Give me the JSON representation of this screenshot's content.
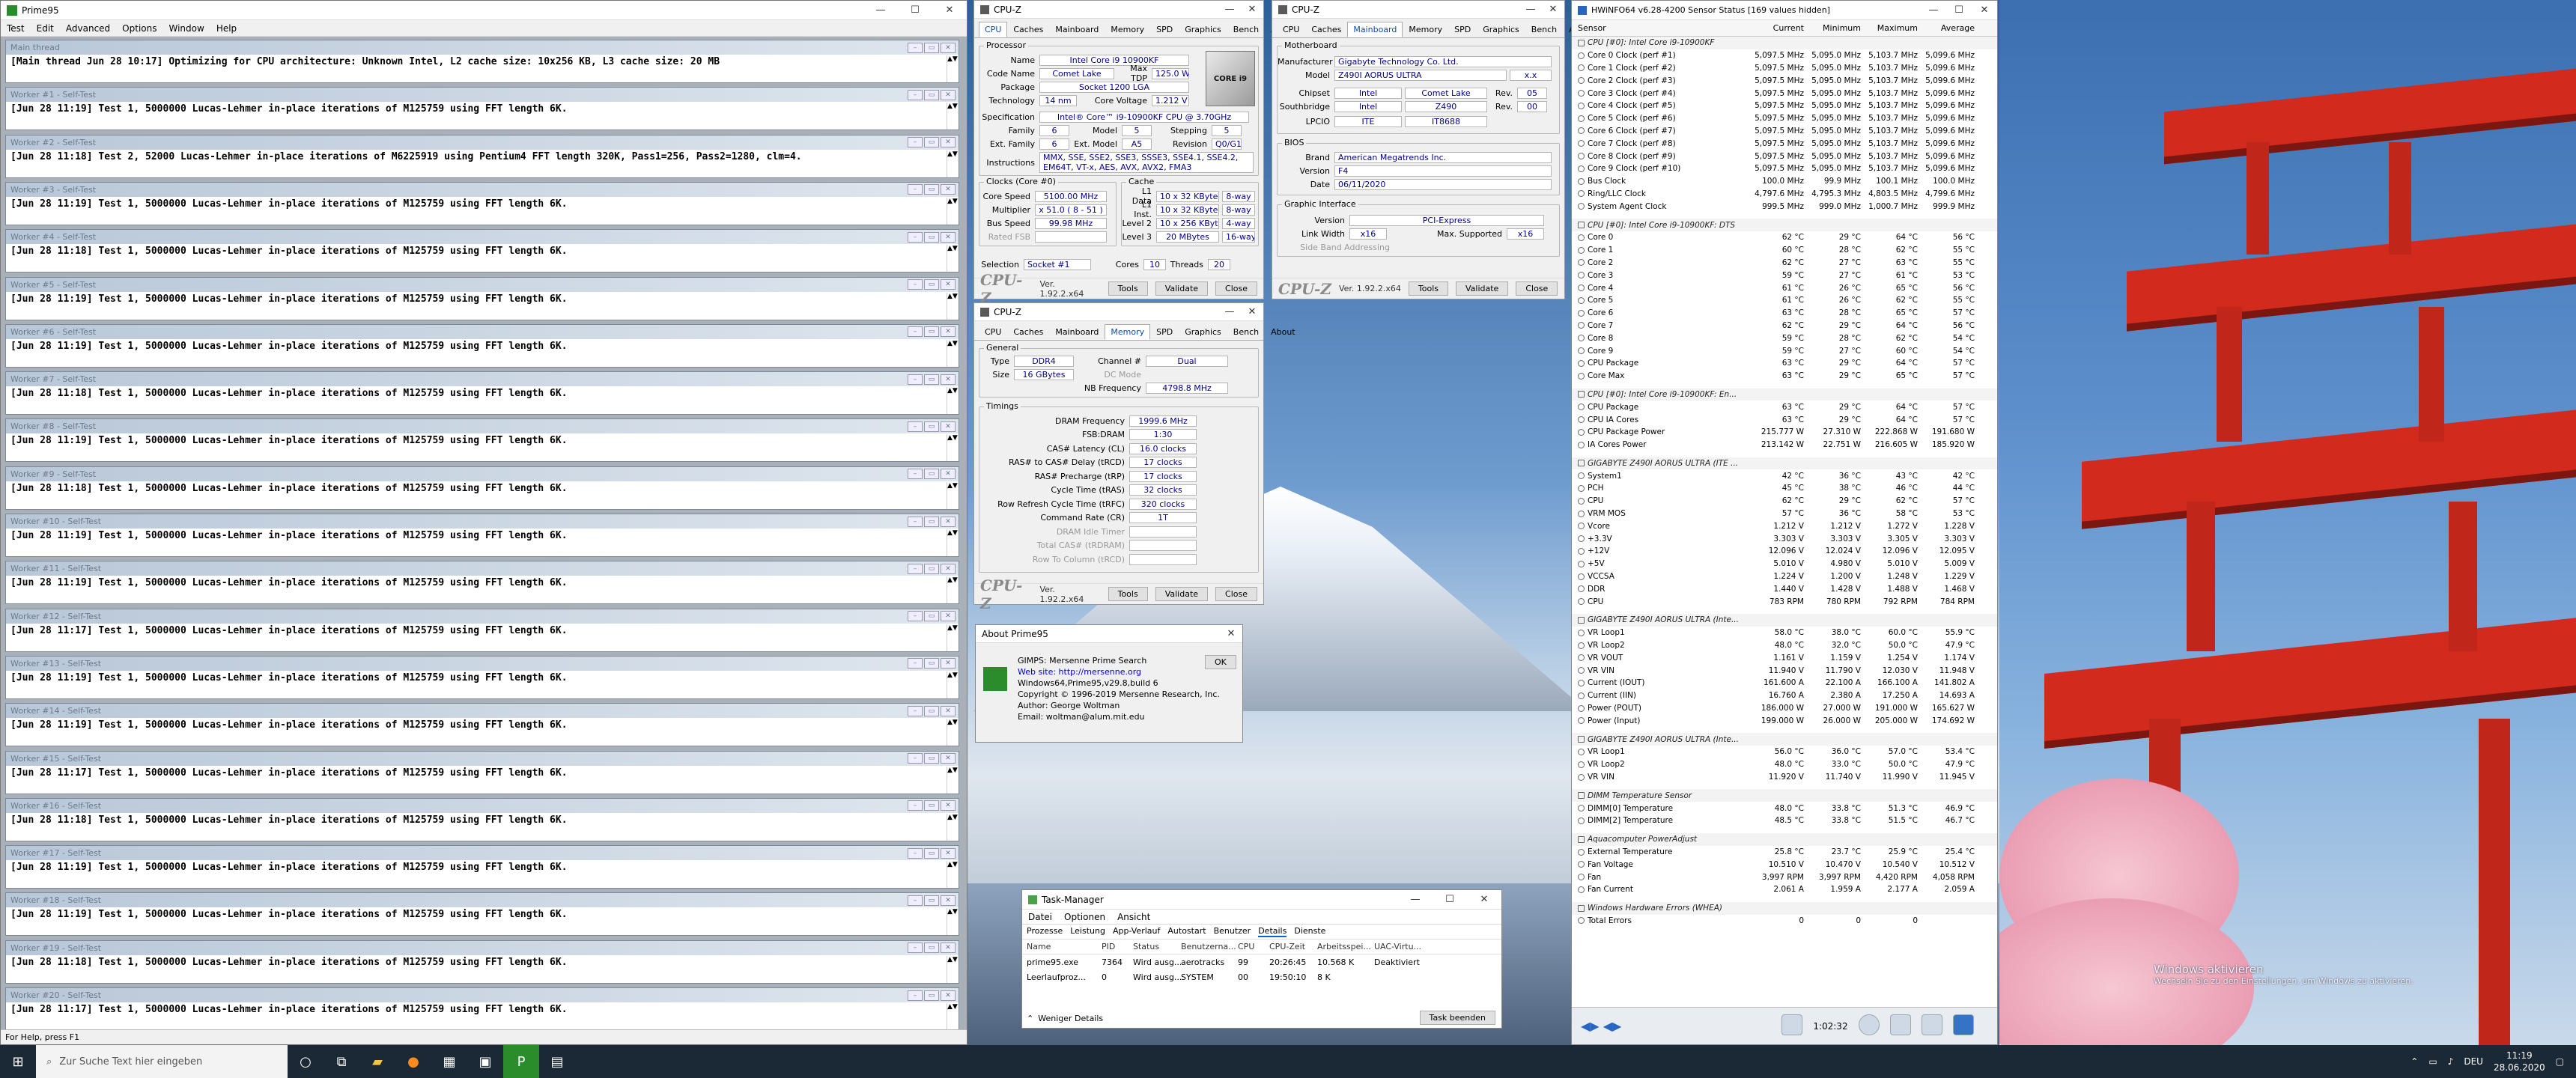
{
  "prime": {
    "title": "Prime95",
    "menu": [
      "Test",
      "Edit",
      "Advanced",
      "Options",
      "Window",
      "Help"
    ],
    "status": "For Help, press F1",
    "workers": [
      {
        "title": "Main thread",
        "line": "[Main thread Jun 28 10:17] Optimizing for CPU architecture: Unknown Intel, L2 cache size: 10x256 KB, L3 cache size: 20 MB"
      },
      {
        "title": "Worker #1 - Self-Test",
        "line": "[Jun 28 11:19] Test 1, 5000000 Lucas-Lehmer in-place iterations of M125759 using FFT length 6K."
      },
      {
        "title": "Worker #2 - Self-Test",
        "line": "[Jun 28 11:18] Test 2, 52000 Lucas-Lehmer in-place iterations of M6225919 using Pentium4 FFT length 320K, Pass1=256, Pass2=1280, clm=4."
      },
      {
        "title": "Worker #3 - Self-Test",
        "line": "[Jun 28 11:19] Test 1, 5000000 Lucas-Lehmer in-place iterations of M125759 using FFT length 6K."
      },
      {
        "title": "Worker #4 - Self-Test",
        "line": "[Jun 28 11:18] Test 1, 5000000 Lucas-Lehmer in-place iterations of M125759 using FFT length 6K."
      },
      {
        "title": "Worker #5 - Self-Test",
        "line": "[Jun 28 11:19] Test 1, 5000000 Lucas-Lehmer in-place iterations of M125759 using FFT length 6K."
      },
      {
        "title": "Worker #6 - Self-Test",
        "line": "[Jun 28 11:19] Test 1, 5000000 Lucas-Lehmer in-place iterations of M125759 using FFT length 6K."
      },
      {
        "title": "Worker #7 - Self-Test",
        "line": "[Jun 28 11:18] Test 1, 5000000 Lucas-Lehmer in-place iterations of M125759 using FFT length 6K."
      },
      {
        "title": "Worker #8 - Self-Test",
        "line": "[Jun 28 11:19] Test 1, 5000000 Lucas-Lehmer in-place iterations of M125759 using FFT length 6K."
      },
      {
        "title": "Worker #9 - Self-Test",
        "line": "[Jun 28 11:18] Test 1, 5000000 Lucas-Lehmer in-place iterations of M125759 using FFT length 6K."
      },
      {
        "title": "Worker #10 - Self-Test",
        "line": "[Jun 28 11:19] Test 1, 5000000 Lucas-Lehmer in-place iterations of M125759 using FFT length 6K."
      },
      {
        "title": "Worker #11 - Self-Test",
        "line": "[Jun 28 11:19] Test 1, 5000000 Lucas-Lehmer in-place iterations of M125759 using FFT length 6K."
      },
      {
        "title": "Worker #12 - Self-Test",
        "line": "[Jun 28 11:17] Test 1, 5000000 Lucas-Lehmer in-place iterations of M125759 using FFT length 6K."
      },
      {
        "title": "Worker #13 - Self-Test",
        "line": "[Jun 28 11:19] Test 1, 5000000 Lucas-Lehmer in-place iterations of M125759 using FFT length 6K."
      },
      {
        "title": "Worker #14 - Self-Test",
        "line": "[Jun 28 11:19] Test 1, 5000000 Lucas-Lehmer in-place iterations of M125759 using FFT length 6K."
      },
      {
        "title": "Worker #15 - Self-Test",
        "line": "[Jun 28 11:17] Test 1, 5000000 Lucas-Lehmer in-place iterations of M125759 using FFT length 6K."
      },
      {
        "title": "Worker #16 - Self-Test",
        "line": "[Jun 28 11:18] Test 1, 5000000 Lucas-Lehmer in-place iterations of M125759 using FFT length 6K."
      },
      {
        "title": "Worker #17 - Self-Test",
        "line": "[Jun 28 11:19] Test 1, 5000000 Lucas-Lehmer in-place iterations of M125759 using FFT length 6K."
      },
      {
        "title": "Worker #18 - Self-Test",
        "line": "[Jun 28 11:19] Test 1, 5000000 Lucas-Lehmer in-place iterations of M125759 using FFT length 6K."
      },
      {
        "title": "Worker #19 - Self-Test",
        "line": "[Jun 28 11:18] Test 1, 5000000 Lucas-Lehmer in-place iterations of M125759 using FFT length 6K."
      },
      {
        "title": "Worker #20 - Self-Test",
        "line": "[Jun 28 11:17] Test 1, 5000000 Lucas-Lehmer in-place iterations of M125759 using FFT length 6K."
      }
    ]
  },
  "cpuz1": {
    "title": "CPU-Z",
    "tabs": [
      "CPU",
      "Caches",
      "Mainboard",
      "Memory",
      "SPD",
      "Graphics",
      "Bench",
      "About"
    ],
    "processor": "Processor",
    "name_k": "Name",
    "name": "Intel Core i9 10900KF",
    "code_k": "Code Name",
    "code": "Comet Lake",
    "tdp_k": "Max TDP",
    "tdp": "125.0 W",
    "pkg_k": "Package",
    "pkg": "Socket 1200 LGA",
    "tech_k": "Technology",
    "tech": "14 nm",
    "volt_k": "Core Voltage",
    "volt": "1.212 V",
    "spec_k": "Specification",
    "spec": "Intel® Core™ i9-10900KF CPU @ 3.70GHz",
    "fam_k": "Family",
    "fam": "6",
    "model_k": "Model",
    "model": "5",
    "step_k": "Stepping",
    "step": "5",
    "efam_k": "Ext. Family",
    "efam": "6",
    "emod_k": "Ext. Model",
    "emod": "A5",
    "rev_k": "Revision",
    "rev": "Q0/G1",
    "instr_k": "Instructions",
    "instr": "MMX, SSE, SSE2, SSE3, SSSE3, SSE4.1, SSE4.2, EM64T, VT-x, AES, AVX, AVX2, FMA3",
    "clocks": "Clocks (Core #0)",
    "cs_k": "Core Speed",
    "cs": "5100.00 MHz",
    "mul_k": "Multiplier",
    "mul": "x 51.0 ( 8 - 51 )",
    "bus_k": "Bus Speed",
    "bus": "99.98 MHz",
    "fsb_k": "Rated FSB",
    "cache": "Cache",
    "l1d_k": "L1 Data",
    "l1d": "10 x 32 KBytes",
    "l1d_w": "8-way",
    "l1i_k": "L1 Inst.",
    "l1i": "10 x 32 KBytes",
    "l1i_w": "8-way",
    "l2_k": "Level 2",
    "l2": "10 x 256 KBytes",
    "l2_w": "4-way",
    "l3_k": "Level 3",
    "l3": "20 MBytes",
    "l3_w": "16-way",
    "sel_k": "Selection",
    "sel": "Socket #1",
    "cores_k": "Cores",
    "cores": "10",
    "thr_k": "Threads",
    "thr": "20",
    "logo": "CPU-Z",
    "ver": "Ver. 1.92.2.x64",
    "tools": "Tools",
    "validate": "Validate",
    "close": "Close",
    "badge": "CORE i9"
  },
  "cpuz2": {
    "title": "CPU-Z",
    "tabs": [
      "CPU",
      "Caches",
      "Mainboard",
      "Memory",
      "SPD",
      "Graphics",
      "Bench",
      "About"
    ],
    "mb": "Motherboard",
    "man_k": "Manufacturer",
    "man": "Gigabyte Technology Co. Ltd.",
    "model_k": "Model",
    "model": "Z490I AORUS ULTRA",
    "model_r": "x.x",
    "chip_k": "Chipset",
    "chip": "Intel",
    "chip2": "Comet Lake",
    "chip_rev_k": "Rev.",
    "chip_rev": "05",
    "sb_k": "Southbridge",
    "sb": "Intel",
    "sb2": "Z490",
    "sb_rev": "00",
    "lpc_k": "LPCIO",
    "lpc": "ITE",
    "lpc2": "IT8688",
    "bios": "BIOS",
    "brand_k": "Brand",
    "brand": "American Megatrends Inc.",
    "bver_k": "Version",
    "bver": "F4",
    "date_k": "Date",
    "date": "06/11/2020",
    "gi": "Graphic Interface",
    "gv_k": "Version",
    "gv": "PCI-Express",
    "lw_k": "Link Width",
    "lw": "x16",
    "ms_k": "Max. Supported",
    "ms": "x16",
    "sba_k": "Side Band Addressing",
    "logo": "CPU-Z",
    "ver": "Ver. 1.92.2.x64",
    "tools": "Tools",
    "validate": "Validate",
    "close": "Close"
  },
  "cpuz3": {
    "title": "CPU-Z",
    "tabs": [
      "CPU",
      "Caches",
      "Mainboard",
      "Memory",
      "SPD",
      "Graphics",
      "Bench",
      "About"
    ],
    "gen": "General",
    "type_k": "Type",
    "type": "DDR4",
    "ch_k": "Channel #",
    "ch": "Dual",
    "size_k": "Size",
    "size": "16 GBytes",
    "dc_k": "DC Mode",
    "nb_k": "NB Frequency",
    "nb": "4798.8 MHz",
    "tim": "Timings",
    "t": [
      [
        "DRAM Frequency",
        "1999.6 MHz"
      ],
      [
        "FSB:DRAM",
        "1:30"
      ],
      [
        "CAS# Latency (CL)",
        "16.0 clocks"
      ],
      [
        "RAS# to CAS# Delay (tRCD)",
        "17 clocks"
      ],
      [
        "RAS# Precharge (tRP)",
        "17 clocks"
      ],
      [
        "Cycle Time (tRAS)",
        "32 clocks"
      ],
      [
        "Row Refresh Cycle Time (tRFC)",
        "320 clocks"
      ],
      [
        "Command Rate (CR)",
        "1T"
      ],
      [
        "DRAM Idle Timer",
        ""
      ],
      [
        "Total CAS# (tRDRAM)",
        ""
      ],
      [
        "Row To Column (tRCD)",
        ""
      ]
    ],
    "logo": "CPU-Z",
    "ver": "Ver. 1.92.2.x64",
    "tools": "Tools",
    "validate": "Validate",
    "close": "Close"
  },
  "about": {
    "title": "About Prime95",
    "l1": "GIMPS: Mersenne Prime Search",
    "l2": "Web site: http://mersenne.org",
    "l3": "Windows64,Prime95,v29.8,build 6",
    "l4": "Copyright © 1996-2019 Mersenne Research, Inc.",
    "l5": "Author: George Woltman",
    "l6": "Email:  woltman@alum.mit.edu",
    "ok": "OK"
  },
  "tm": {
    "title": "Task-Manager",
    "menu": [
      "Datei",
      "Optionen",
      "Ansicht"
    ],
    "tabs": [
      "Prozesse",
      "Leistung",
      "App-Verlauf",
      "Autostart",
      "Benutzer",
      "Details",
      "Dienste"
    ],
    "cols": [
      "Name",
      "PID",
      "Status",
      "Benutzerna...",
      "CPU",
      "CPU-Zeit",
      "Arbeitsspei...",
      "UAC-Virtu..."
    ],
    "rows": [
      [
        "prime95.exe",
        "7364",
        "Wird ausg...",
        "aerotracks",
        "99",
        "20:26:45",
        "10.568 K",
        "Deaktiviert"
      ],
      [
        "Leerlaufproz...",
        "0",
        "Wird ausg...",
        "SYSTEM",
        "00",
        "19:50:10",
        "8 K",
        ""
      ]
    ],
    "less": "Weniger Details",
    "end": "Task beenden"
  },
  "hw": {
    "title": "HWiNFO64 v6.28-4200 Sensor Status [169 values hidden]",
    "cols": [
      "Sensor",
      "Current",
      "Minimum",
      "Maximum",
      "Average"
    ],
    "rows": [
      {
        "s": 1,
        "n": "CPU [#0]: Intel Core i9-10900KF"
      },
      {
        "n": "Core 0 Clock (perf #1)",
        "a": "5,097.5 MHz",
        "b": "5,095.0 MHz",
        "c": "5,103.7 MHz",
        "d": "5,099.6 MHz"
      },
      {
        "n": "Core 1 Clock (perf #2)",
        "a": "5,097.5 MHz",
        "b": "5,095.0 MHz",
        "c": "5,103.7 MHz",
        "d": "5,099.6 MHz"
      },
      {
        "n": "Core 2 Clock (perf #3)",
        "a": "5,097.5 MHz",
        "b": "5,095.0 MHz",
        "c": "5,103.7 MHz",
        "d": "5,099.6 MHz"
      },
      {
        "n": "Core 3 Clock (perf #4)",
        "a": "5,097.5 MHz",
        "b": "5,095.0 MHz",
        "c": "5,103.7 MHz",
        "d": "5,099.6 MHz"
      },
      {
        "n": "Core 4 Clock (perf #5)",
        "a": "5,097.5 MHz",
        "b": "5,095.0 MHz",
        "c": "5,103.7 MHz",
        "d": "5,099.6 MHz"
      },
      {
        "n": "Core 5 Clock (perf #6)",
        "a": "5,097.5 MHz",
        "b": "5,095.0 MHz",
        "c": "5,103.7 MHz",
        "d": "5,099.6 MHz"
      },
      {
        "n": "Core 6 Clock (perf #7)",
        "a": "5,097.5 MHz",
        "b": "5,095.0 MHz",
        "c": "5,103.7 MHz",
        "d": "5,099.6 MHz"
      },
      {
        "n": "Core 7 Clock (perf #8)",
        "a": "5,097.5 MHz",
        "b": "5,095.0 MHz",
        "c": "5,103.7 MHz",
        "d": "5,099.6 MHz"
      },
      {
        "n": "Core 8 Clock (perf #9)",
        "a": "5,097.5 MHz",
        "b": "5,095.0 MHz",
        "c": "5,103.7 MHz",
        "d": "5,099.6 MHz"
      },
      {
        "n": "Core 9 Clock (perf #10)",
        "a": "5,097.5 MHz",
        "b": "5,095.0 MHz",
        "c": "5,103.7 MHz",
        "d": "5,099.6 MHz"
      },
      {
        "n": "Bus Clock",
        "a": "100.0 MHz",
        "b": "99.9 MHz",
        "c": "100.1 MHz",
        "d": "100.0 MHz"
      },
      {
        "n": "Ring/LLC Clock",
        "a": "4,797.6 MHz",
        "b": "4,795.3 MHz",
        "c": "4,803.5 MHz",
        "d": "4,799.6 MHz"
      },
      {
        "n": "System Agent Clock",
        "a": "999.5 MHz",
        "b": "999.0 MHz",
        "c": "1,000.7 MHz",
        "d": "999.9 MHz"
      },
      {
        "g": 1
      },
      {
        "s": 1,
        "n": "CPU [#0]: Intel Core i9-10900KF: DTS"
      },
      {
        "n": "Core 0",
        "a": "62 °C",
        "b": "29 °C",
        "c": "64 °C",
        "d": "56 °C"
      },
      {
        "n": "Core 1",
        "a": "60 °C",
        "b": "28 °C",
        "c": "62 °C",
        "d": "55 °C"
      },
      {
        "n": "Core 2",
        "a": "62 °C",
        "b": "27 °C",
        "c": "63 °C",
        "d": "55 °C"
      },
      {
        "n": "Core 3",
        "a": "59 °C",
        "b": "27 °C",
        "c": "61 °C",
        "d": "53 °C"
      },
      {
        "n": "Core 4",
        "a": "61 °C",
        "b": "26 °C",
        "c": "65 °C",
        "d": "56 °C"
      },
      {
        "n": "Core 5",
        "a": "61 °C",
        "b": "26 °C",
        "c": "62 °C",
        "d": "55 °C"
      },
      {
        "n": "Core 6",
        "a": "63 °C",
        "b": "28 °C",
        "c": "65 °C",
        "d": "57 °C"
      },
      {
        "n": "Core 7",
        "a": "62 °C",
        "b": "29 °C",
        "c": "64 °C",
        "d": "56 °C"
      },
      {
        "n": "Core 8",
        "a": "59 °C",
        "b": "28 °C",
        "c": "62 °C",
        "d": "54 °C"
      },
      {
        "n": "Core 9",
        "a": "59 °C",
        "b": "27 °C",
        "c": "60 °C",
        "d": "54 °C"
      },
      {
        "n": "CPU Package",
        "a": "63 °C",
        "b": "29 °C",
        "c": "64 °C",
        "d": "57 °C"
      },
      {
        "n": "Core Max",
        "a": "63 °C",
        "b": "29 °C",
        "c": "65 °C",
        "d": "57 °C"
      },
      {
        "g": 1
      },
      {
        "s": 1,
        "n": "CPU [#0]: Intel Core i9-10900KF: En..."
      },
      {
        "n": "CPU Package",
        "a": "63 °C",
        "b": "29 °C",
        "c": "64 °C",
        "d": "57 °C"
      },
      {
        "n": "CPU IA Cores",
        "a": "63 °C",
        "b": "29 °C",
        "c": "64 °C",
        "d": "57 °C"
      },
      {
        "n": "CPU Package Power",
        "a": "215.777 W",
        "b": "27.310 W",
        "c": "222.868 W",
        "d": "191.680 W"
      },
      {
        "n": "IA Cores Power",
        "a": "213.142 W",
        "b": "22.751 W",
        "c": "216.605 W",
        "d": "185.920 W"
      },
      {
        "g": 1
      },
      {
        "s": 1,
        "n": "GIGABYTE Z490I AORUS ULTRA (ITE ..."
      },
      {
        "n": "System1",
        "a": "42 °C",
        "b": "36 °C",
        "c": "43 °C",
        "d": "42 °C"
      },
      {
        "n": "PCH",
        "a": "45 °C",
        "b": "38 °C",
        "c": "46 °C",
        "d": "44 °C"
      },
      {
        "n": "CPU",
        "a": "62 °C",
        "b": "29 °C",
        "c": "62 °C",
        "d": "57 °C"
      },
      {
        "n": "VRM MOS",
        "a": "57 °C",
        "b": "36 °C",
        "c": "58 °C",
        "d": "53 °C"
      },
      {
        "n": "Vcore",
        "a": "1.212 V",
        "b": "1.212 V",
        "c": "1.272 V",
        "d": "1.228 V"
      },
      {
        "n": "+3.3V",
        "a": "3.303 V",
        "b": "3.303 V",
        "c": "3.305 V",
        "d": "3.303 V"
      },
      {
        "n": "+12V",
        "a": "12.096 V",
        "b": "12.024 V",
        "c": "12.096 V",
        "d": "12.095 V"
      },
      {
        "n": "+5V",
        "a": "5.010 V",
        "b": "4.980 V",
        "c": "5.010 V",
        "d": "5.009 V"
      },
      {
        "n": "VCCSA",
        "a": "1.224 V",
        "b": "1.200 V",
        "c": "1.248 V",
        "d": "1.229 V"
      },
      {
        "n": "DDR",
        "a": "1.440 V",
        "b": "1.428 V",
        "c": "1.488 V",
        "d": "1.468 V"
      },
      {
        "n": "CPU",
        "a": "783 RPM",
        "b": "780 RPM",
        "c": "792 RPM",
        "d": "784 RPM"
      },
      {
        "g": 1
      },
      {
        "s": 1,
        "n": "GIGABYTE Z490I AORUS ULTRA (Inte..."
      },
      {
        "n": "VR Loop1",
        "a": "58.0 °C",
        "b": "38.0 °C",
        "c": "60.0 °C",
        "d": "55.9 °C"
      },
      {
        "n": "VR Loop2",
        "a": "48.0 °C",
        "b": "32.0 °C",
        "c": "50.0 °C",
        "d": "47.9 °C"
      },
      {
        "n": "VR VOUT",
        "a": "1.161 V",
        "b": "1.159 V",
        "c": "1.254 V",
        "d": "1.174 V"
      },
      {
        "n": "VR VIN",
        "a": "11.940 V",
        "b": "11.790 V",
        "c": "12.030 V",
        "d": "11.948 V"
      },
      {
        "n": "Current (IOUT)",
        "a": "161.600 A",
        "b": "22.100 A",
        "c": "166.100 A",
        "d": "141.802 A"
      },
      {
        "n": "Current (IIN)",
        "a": "16.760 A",
        "b": "2.380 A",
        "c": "17.250 A",
        "d": "14.693 A"
      },
      {
        "n": "Power (POUT)",
        "a": "186.000 W",
        "b": "27.000 W",
        "c": "191.000 W",
        "d": "165.627 W"
      },
      {
        "n": "Power (Input)",
        "a": "199.000 W",
        "b": "26.000 W",
        "c": "205.000 W",
        "d": "174.692 W"
      },
      {
        "g": 1
      },
      {
        "s": 1,
        "n": "GIGABYTE Z490I AORUS ULTRA (Inte..."
      },
      {
        "n": "VR Loop1",
        "a": "56.0 °C",
        "b": "36.0 °C",
        "c": "57.0 °C",
        "d": "53.4 °C"
      },
      {
        "n": "VR Loop2",
        "a": "48.0 °C",
        "b": "33.0 °C",
        "c": "50.0 °C",
        "d": "47.9 °C"
      },
      {
        "n": "VR VIN",
        "a": "11.920 V",
        "b": "11.740 V",
        "c": "11.990 V",
        "d": "11.945 V"
      },
      {
        "g": 1
      },
      {
        "s": 1,
        "n": "DIMM Temperature Sensor"
      },
      {
        "n": "DIMM[0] Temperature",
        "a": "48.0 °C",
        "b": "33.8 °C",
        "c": "51.3 °C",
        "d": "46.9 °C"
      },
      {
        "n": "DIMM[2] Temperature",
        "a": "48.5 °C",
        "b": "33.8 °C",
        "c": "51.5 °C",
        "d": "46.7 °C"
      },
      {
        "g": 1
      },
      {
        "s": 1,
        "n": "Aquacomputer PowerAdjust"
      },
      {
        "n": "External Temperature",
        "a": "25.8 °C",
        "b": "23.7 °C",
        "c": "25.9 °C",
        "d": "25.4 °C"
      },
      {
        "n": "Fan Voltage",
        "a": "10.510 V",
        "b": "10.470 V",
        "c": "10.540 V",
        "d": "10.512 V"
      },
      {
        "n": "Fan",
        "a": "3,997 RPM",
        "b": "3,997 RPM",
        "c": "4,420 RPM",
        "d": "4,058 RPM"
      },
      {
        "n": "Fan Current",
        "a": "2.061 A",
        "b": "1.959 A",
        "c": "2.177 A",
        "d": "2.059 A"
      },
      {
        "g": 1
      },
      {
        "s": 1,
        "n": "Windows Hardware Errors (WHEA)"
      },
      {
        "n": "Total Errors",
        "a": "0",
        "b": "0",
        "c": "0",
        "d": ""
      }
    ],
    "timer": "1:02:32"
  },
  "taskbar": {
    "search": "Zur Suche Text hier eingeben",
    "lang": "DEU",
    "time": "11:19",
    "date": "28.06.2020"
  },
  "desktop": {
    "watermark1": "Windows aktivieren",
    "watermark2": "Wechseln Sie zu den Einstellungen, um Windows zu aktivieren."
  }
}
